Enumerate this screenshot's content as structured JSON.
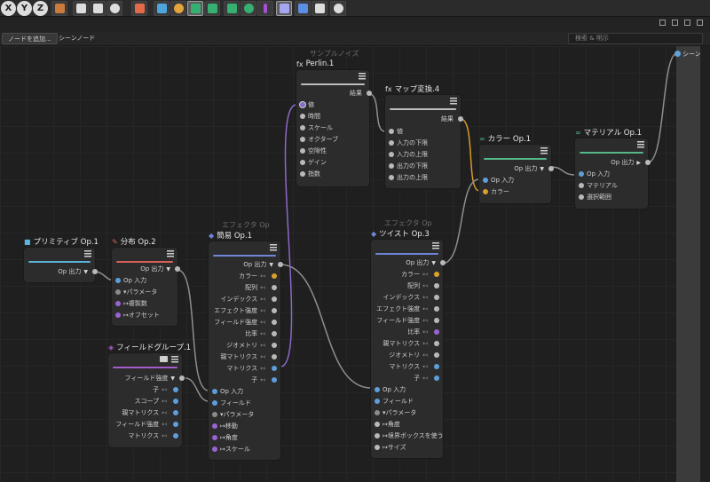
{
  "toolbar": {
    "axis": [
      "X",
      "Y",
      "Z"
    ],
    "icons": [
      {
        "name": "lock-icon",
        "color": "#c87b3a"
      },
      {
        "name": "clapper-icon",
        "color": "#dddddd"
      },
      {
        "name": "render-view-icon",
        "color": "#dddddd"
      },
      {
        "name": "render-settings-icon",
        "color": "#dddddd"
      },
      {
        "name": "node-editor-icon",
        "color": "#e36a49"
      },
      {
        "name": "cube-icon",
        "color": "#4ea4dd"
      },
      {
        "name": "pen-icon",
        "color": "#e3a43b"
      },
      {
        "name": "subdivision-icon",
        "color": "#35b070"
      },
      {
        "name": "cloner-icon",
        "color": "#35b070"
      },
      {
        "name": "deformer-icon",
        "color": "#35b070"
      },
      {
        "name": "effector-icon",
        "color": "#35b070"
      },
      {
        "name": "field-icon",
        "color": "#a44fd4"
      },
      {
        "name": "tag-icon",
        "color": "#a6a6f0"
      },
      {
        "name": "floor-icon",
        "color": "#5b8fe3"
      },
      {
        "name": "camera-icon",
        "color": "#dddddd"
      },
      {
        "name": "light-icon",
        "color": "#dddddd"
      }
    ]
  },
  "tabs": {
    "add_node": "ノードを追加...",
    "scene_nodes": "シーンノード",
    "search_placeholder": "検索 & 明示"
  },
  "scene_output": "シーン",
  "nodes": {
    "primitive": {
      "title": "プリミティブ Op.1",
      "bar_color": "#5ab3d8",
      "out": "Op 出力"
    },
    "distribute": {
      "title": "分布 Op.2",
      "bar_color": "#d9605a",
      "out": "Op 出力",
      "inputs": [
        "Op 入力",
        "パラメータ",
        "複製数",
        "オフセット"
      ]
    },
    "fieldgroup": {
      "title": "フィールドグループ.1",
      "bar_color": "#a45cc9",
      "out": "フィールド強度",
      "rows": [
        "子",
        "スコープ",
        "親マトリクス",
        "フィールド強度",
        "マトリクス"
      ]
    },
    "simple": {
      "subtitle": "エフェクタ Op",
      "title": "簡易 Op.1",
      "bar_color": "#6f86d8",
      "out": "Op 出力",
      "rows": [
        "カラー",
        "配列",
        "インデックス",
        "エフェクト強度",
        "フィールド強度",
        "比率",
        "ジオメトリ",
        "親マトリクス",
        "マトリクス",
        "子"
      ],
      "inputs": [
        "Op 入力",
        "フィールド",
        "パラメータ",
        "移動",
        "角度",
        "スケール"
      ]
    },
    "perlin": {
      "subtitle": "サンプルノイズ",
      "title": "Perlin.1",
      "bar_color": "#bdbdbd",
      "out": "結果",
      "inputs": [
        "値",
        "時間",
        "スケール",
        "オクターブ",
        "空隙性",
        "ゲイン",
        "指数"
      ]
    },
    "remap": {
      "title": "マップ変換.4",
      "bar_color": "#bdbdbd",
      "out": "結果",
      "inputs": [
        "値",
        "入力の下限",
        "入力の上限",
        "出力の下限",
        "出力の上限"
      ]
    },
    "twist": {
      "subtitle": "エフェクタ Op",
      "title": "ツイスト Op.3",
      "bar_color": "#6f86d8",
      "out": "Op 出力",
      "rows": [
        "カラー",
        "配列",
        "インデックス",
        "エフェクト強度",
        "フィールド強度",
        "比率",
        "親マトリクス",
        "ジオメトリ",
        "マトリクス",
        "子"
      ],
      "inputs": [
        "Op 入力",
        "フィールド",
        "パラメータ",
        "角度",
        "境界ボックスを使う",
        "サイズ"
      ]
    },
    "color": {
      "title": "カラー Op.1",
      "bar_color": "#55b888",
      "out": "Op 出力",
      "inputs": [
        "Op 入力",
        "カラー"
      ]
    },
    "material": {
      "title": "マテリアル Op.1",
      "bar_color": "#55b888",
      "out": "Op 出力",
      "inputs": [
        "Op 入力",
        "マテリアル",
        "選択範囲"
      ]
    }
  },
  "colors": {
    "wire": "#8e8e8e",
    "wire_purple": "#8b69c9",
    "wire_orange": "#d59a2a"
  }
}
